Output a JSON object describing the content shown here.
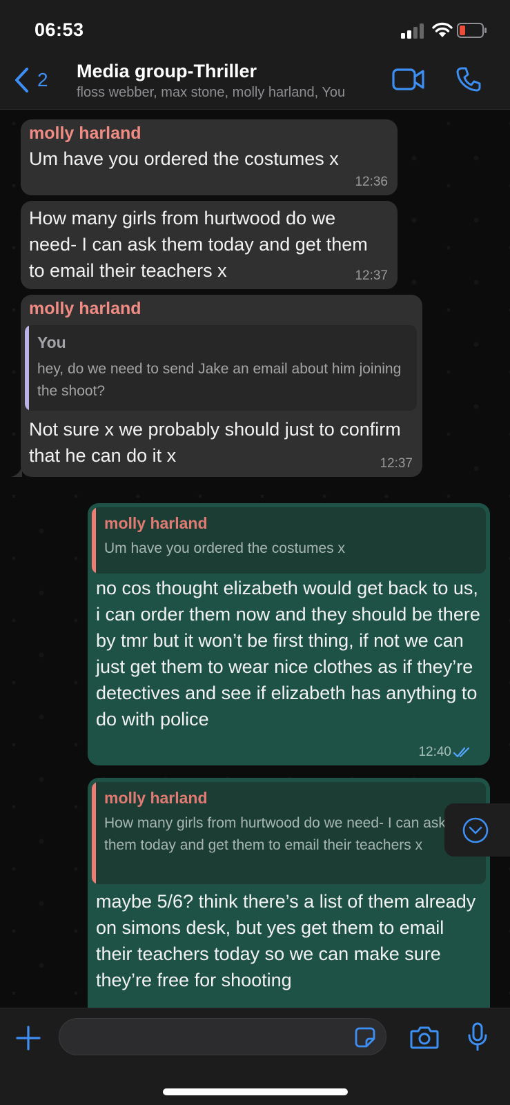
{
  "status_bar": {
    "time": "06:53"
  },
  "header": {
    "back_count": "2",
    "title": "Media group-Thriller",
    "subtitle": "floss webber, max stone, molly harland, You"
  },
  "messages": [
    {
      "direction": "incoming",
      "sender": "molly harland",
      "text": "Um have you ordered the costumes x",
      "time": "12:36"
    },
    {
      "direction": "incoming",
      "text": "How many girls from hurtwood do we need- I can ask them today and get them to email their teachers x",
      "time": "12:37"
    },
    {
      "direction": "incoming",
      "sender": "molly harland",
      "quote": {
        "name": "You",
        "text": "hey, do we need to send Jake an email about him joining the shoot?"
      },
      "text": "Not sure x we probably should just to confirm that he can do it x",
      "time": "12:37"
    },
    {
      "direction": "outgoing",
      "quote": {
        "name": "molly harland",
        "text": "Um have you ordered the costumes x"
      },
      "text": "no cos thought elizabeth would get back to us, i can order them now and they should be there by tmr but it won’t be first thing, if not we can just get them to wear nice clothes as if they’re detectives and see if elizabeth has anything to do with police",
      "time": "12:40",
      "read": true
    },
    {
      "direction": "outgoing",
      "quote": {
        "name": "molly harland",
        "text": "How many girls from hurtwood do we need- I can ask them today and get them to email their teachers x"
      },
      "text": "maybe 5/6? think there’s a list of them already on simons desk, but yes get them to email their teachers today so we can make sure they’re free for shooting"
    }
  ],
  "colors": {
    "accent": "#3d8ff3",
    "incoming_bubble": "#303031",
    "outgoing_bubble": "#1f5246",
    "sender_name": "#f18c84",
    "quote_you_bar": "#b9b3e6",
    "quote_molly_bar": "#f07d74"
  },
  "icons": [
    "back-chevron-icon",
    "video-call-icon",
    "phone-call-icon",
    "plus-icon",
    "sticker-icon",
    "camera-icon",
    "microphone-icon",
    "scroll-down-icon",
    "read-receipt-icon",
    "battery-low-icon",
    "wifi-icon",
    "cellular-signal-icon"
  ]
}
